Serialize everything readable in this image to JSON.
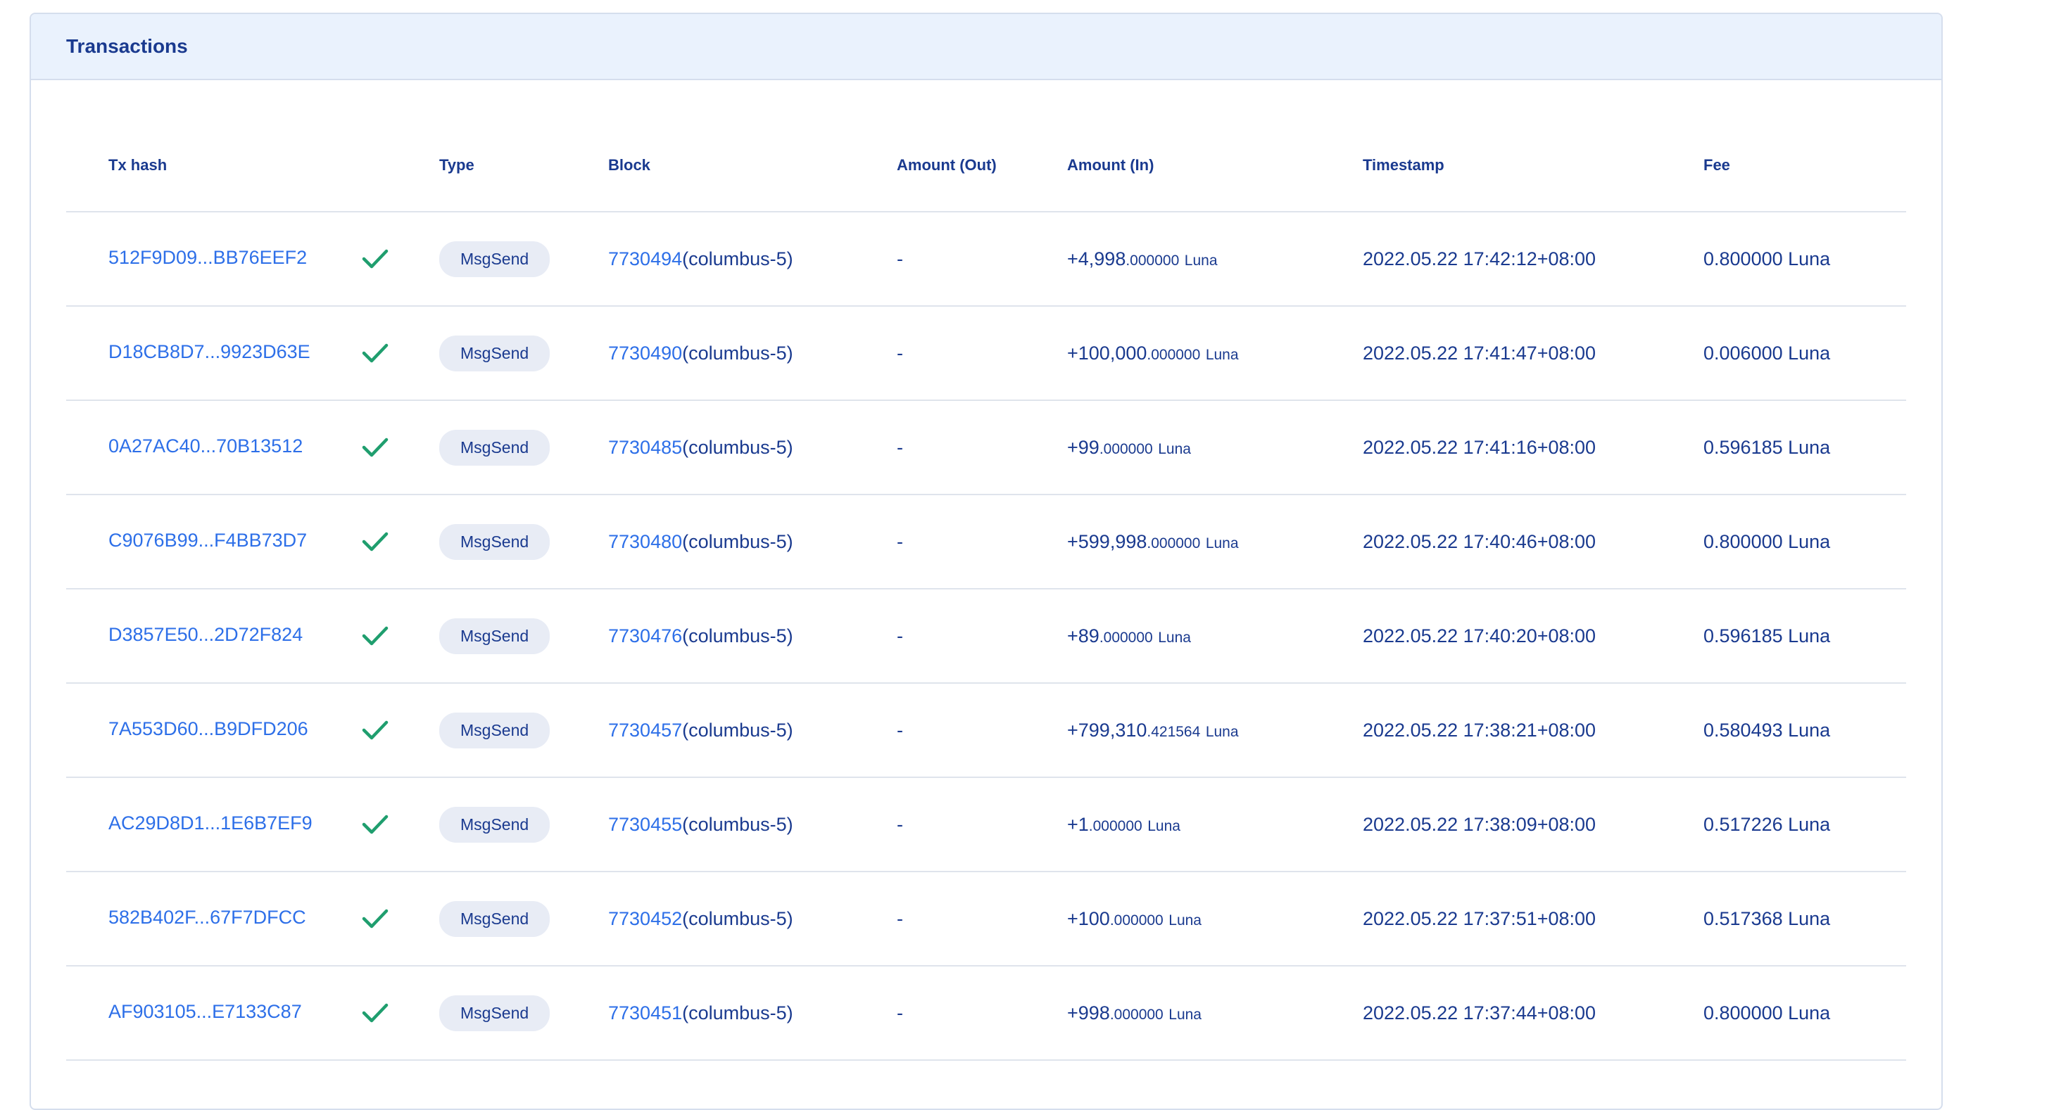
{
  "panel": {
    "title": "Transactions"
  },
  "table": {
    "headers": {
      "tx_hash": "Tx hash",
      "type": "Type",
      "block": "Block",
      "amount_out": "Amount (Out)",
      "amount_in": "Amount (In)",
      "timestamp": "Timestamp",
      "fee": "Fee"
    },
    "rows": [
      {
        "hash": "512F9D09...BB76EEF2",
        "status_icon": "check-icon",
        "type": "MsgSend",
        "block_num": "7730494",
        "block_chain": "(columbus-5)",
        "amount_out": "-",
        "amount_in_int": "+4,998",
        "amount_in_dec": ".000000",
        "amount_in_unit": "Luna",
        "timestamp": "2022.05.22 17:42:12+08:00",
        "fee": "0.800000 Luna"
      },
      {
        "hash": "D18CB8D7...9923D63E",
        "status_icon": "check-icon",
        "type": "MsgSend",
        "block_num": "7730490",
        "block_chain": "(columbus-5)",
        "amount_out": "-",
        "amount_in_int": "+100,000",
        "amount_in_dec": ".000000",
        "amount_in_unit": "Luna",
        "timestamp": "2022.05.22 17:41:47+08:00",
        "fee": "0.006000 Luna"
      },
      {
        "hash": "0A27AC40...70B13512",
        "status_icon": "check-icon",
        "type": "MsgSend",
        "block_num": "7730485",
        "block_chain": "(columbus-5)",
        "amount_out": "-",
        "amount_in_int": "+99",
        "amount_in_dec": ".000000",
        "amount_in_unit": "Luna",
        "timestamp": "2022.05.22 17:41:16+08:00",
        "fee": "0.596185 Luna"
      },
      {
        "hash": "C9076B99...F4BB73D7",
        "status_icon": "check-icon",
        "type": "MsgSend",
        "block_num": "7730480",
        "block_chain": "(columbus-5)",
        "amount_out": "-",
        "amount_in_int": "+599,998",
        "amount_in_dec": ".000000",
        "amount_in_unit": "Luna",
        "timestamp": "2022.05.22 17:40:46+08:00",
        "fee": "0.800000 Luna"
      },
      {
        "hash": "D3857E50...2D72F824",
        "status_icon": "check-icon",
        "type": "MsgSend",
        "block_num": "7730476",
        "block_chain": "(columbus-5)",
        "amount_out": "-",
        "amount_in_int": "+89",
        "amount_in_dec": ".000000",
        "amount_in_unit": "Luna",
        "timestamp": "2022.05.22 17:40:20+08:00",
        "fee": "0.596185 Luna"
      },
      {
        "hash": "7A553D60...B9DFD206",
        "status_icon": "check-icon",
        "type": "MsgSend",
        "block_num": "7730457",
        "block_chain": "(columbus-5)",
        "amount_out": "-",
        "amount_in_int": "+799,310",
        "amount_in_dec": ".421564",
        "amount_in_unit": "Luna",
        "timestamp": "2022.05.22 17:38:21+08:00",
        "fee": "0.580493 Luna"
      },
      {
        "hash": "AC29D8D1...1E6B7EF9",
        "status_icon": "check-icon",
        "type": "MsgSend",
        "block_num": "7730455",
        "block_chain": "(columbus-5)",
        "amount_out": "-",
        "amount_in_int": "+1",
        "amount_in_dec": ".000000",
        "amount_in_unit": "Luna",
        "timestamp": "2022.05.22 17:38:09+08:00",
        "fee": "0.517226 Luna"
      },
      {
        "hash": "582B402F...67F7DFCC",
        "status_icon": "check-icon",
        "type": "MsgSend",
        "block_num": "7730452",
        "block_chain": "(columbus-5)",
        "amount_out": "-",
        "amount_in_int": "+100",
        "amount_in_dec": ".000000",
        "amount_in_unit": "Luna",
        "timestamp": "2022.05.22 17:37:51+08:00",
        "fee": "0.517368 Luna"
      },
      {
        "hash": "AF903105...E7133C87",
        "status_icon": "check-icon",
        "type": "MsgSend",
        "block_num": "7730451",
        "block_chain": "(columbus-5)",
        "amount_out": "-",
        "amount_in_int": "+998",
        "amount_in_dec": ".000000",
        "amount_in_unit": "Luna",
        "timestamp": "2022.05.22 17:37:44+08:00",
        "fee": "0.800000 Luna"
      }
    ]
  },
  "colors": {
    "header_bg": "#eaf2fd",
    "link": "#2d6fe8",
    "text": "#1a3a8f",
    "success": "#1f9e6e",
    "badge_bg": "#e8ecf5"
  }
}
